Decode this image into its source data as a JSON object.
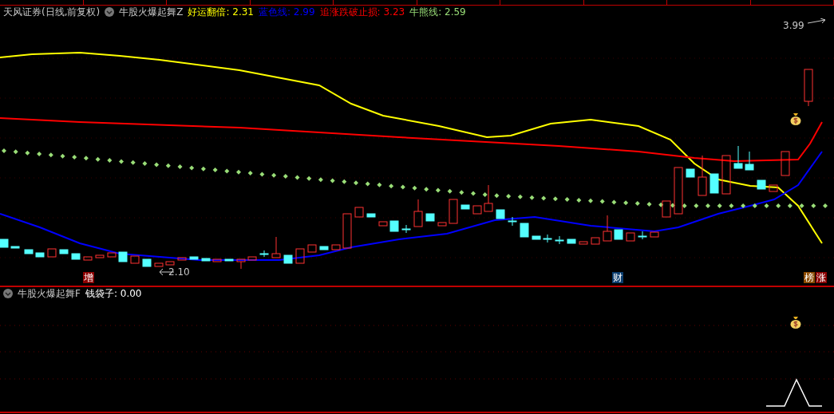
{
  "main_panel": {
    "source": "天风证券(日线,前复权)",
    "indicator": "牛股火爆起舞Z",
    "legend": [
      {
        "text": "好运翻倍: 2.31",
        "color": "#ffff00"
      },
      {
        "text": "蓝色线: 2.99",
        "color": "#0000ff"
      },
      {
        "text": "追涨跌破止损: 3.23",
        "color": "#ff0000"
      },
      {
        "text": "牛熊线: 2.59",
        "color": "#99dd77"
      }
    ],
    "high_label": "3.99",
    "low_label": "2.10",
    "markers": [
      {
        "text": "增",
        "color": "#8b0000"
      },
      {
        "text": "财",
        "color": "#0a3d6e"
      },
      {
        "text": "榜",
        "color": "#8b4a00"
      },
      {
        "text": "涨",
        "color": "#8b0000"
      }
    ]
  },
  "sub_panel": {
    "indicator": "牛股火爆起舞F",
    "legend": [
      {
        "text": "钱袋子: 0.00",
        "color": "#ffffff"
      }
    ]
  }
}
